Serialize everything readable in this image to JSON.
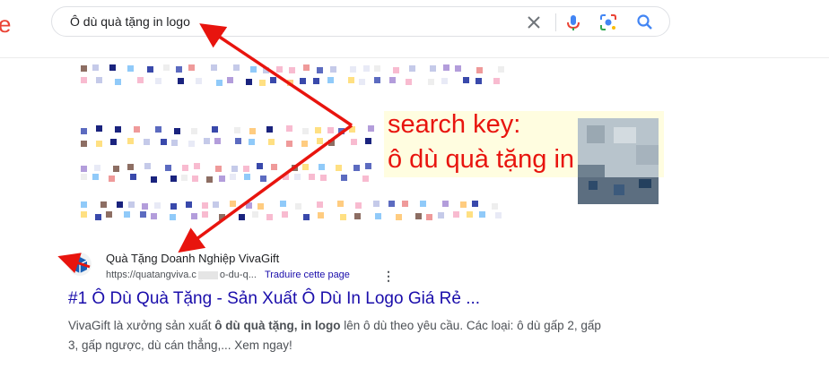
{
  "header": {
    "logo_fragment": "e",
    "search": {
      "query": "Ô dù quà tặng in logo",
      "icons": [
        "clear-icon",
        "microphone-icon",
        "lens-icon",
        "search-icon"
      ]
    }
  },
  "annotation": {
    "line1": "search key:",
    "line2": "ô dù quà tặng in logo",
    "color": "#e8140e"
  },
  "result": {
    "site_name": "Quà Tặng Doanh Nghiệp VivaGift",
    "url_start": "https://quatangviva.c",
    "url_end": "o-du-q...",
    "translate_label": "Traduire cette page",
    "title": "#1 Ô Dù Quà Tặng - Sản Xuất Ô Dù In Logo Giá Rẻ ...",
    "snippet": {
      "part1": "VivaGift là xưởng sản xuất ",
      "bold": "ô dù quà tặng, in logo",
      "part2": " lên ô dù theo yêu cầu. Các loại: ô dù gấp 2, gấp 3, gấp ngược, dù cán thẳng,... Xem ngay!"
    }
  },
  "colors": {
    "link": "#1a0dab",
    "annotation_bg": "#fffde0",
    "accent_red": "#e8140e"
  }
}
